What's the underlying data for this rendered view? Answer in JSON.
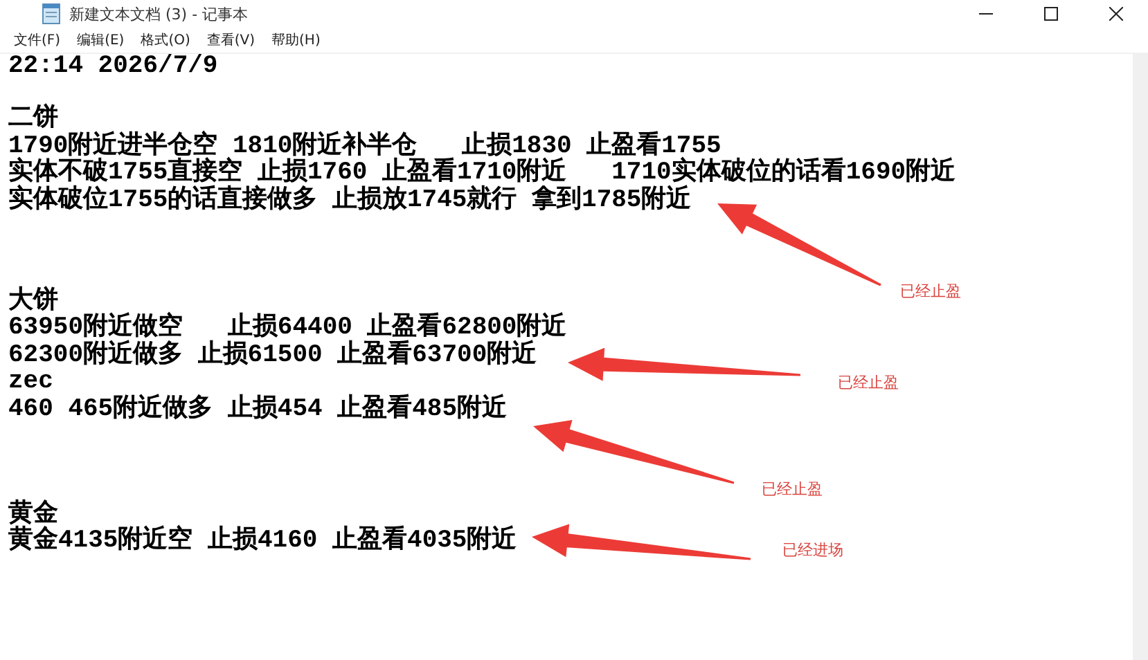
{
  "window": {
    "title": "新建文本文档 (3) - 记事本"
  },
  "menu": [
    "文件(F)",
    "编辑(E)",
    "格式(O)",
    "查看(V)",
    "帮助(H)"
  ],
  "sections": [
    {
      "lines": [
        "22:14 2026/7/9"
      ]
    },
    {
      "lines": [
        "二饼",
        "1790附近进半仓空 1810附近补半仓   止损1830 止盈看1755",
        "实体不破1755直接空 止损1760 止盈看1710附近   1710实体破位的话看1690附近",
        "实体破位1755的话直接做多 止损放1745就行 拿到1785附近"
      ]
    },
    {
      "lines": [
        "大饼",
        "63950附近做空   止损64400 止盈看62800附近",
        "62300附近做多 止损61500 止盈看63700附近",
        "zec",
        "460 465附近做多 止损454 止盈看485附近"
      ]
    },
    {
      "lines": [
        "黄金",
        "黄金4135附近空 止损4160 止盈看4035附近"
      ]
    }
  ],
  "annotations": [
    {
      "label": "已经止盈"
    },
    {
      "label": "已经止盈"
    },
    {
      "label": "已经止盈"
    },
    {
      "label": "已经进场"
    }
  ]
}
